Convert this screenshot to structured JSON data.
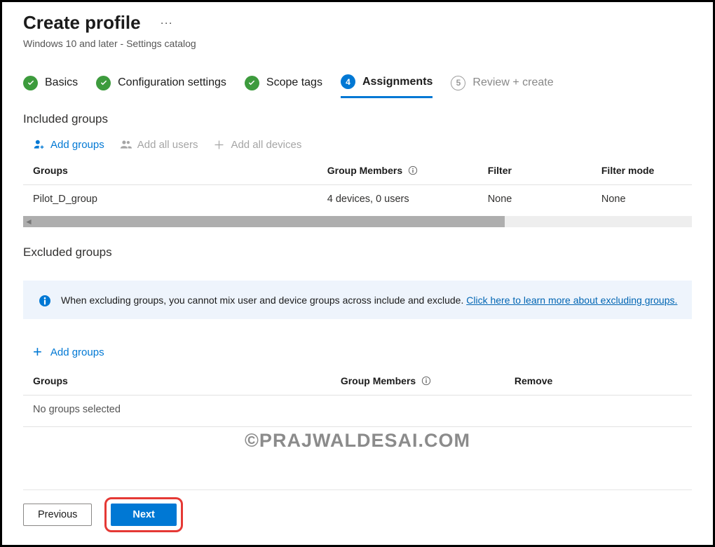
{
  "header": {
    "title": "Create profile",
    "more_label": "···",
    "subtitle": "Windows 10 and later - Settings catalog"
  },
  "wizard": {
    "steps": [
      {
        "label": "Basics",
        "status": "done"
      },
      {
        "label": "Configuration settings",
        "status": "done"
      },
      {
        "label": "Scope tags",
        "status": "done"
      },
      {
        "label": "Assignments",
        "status": "current",
        "number": "4"
      },
      {
        "label": "Review + create",
        "status": "pending",
        "number": "5"
      }
    ]
  },
  "included": {
    "section_title": "Included groups",
    "actions": {
      "add_groups": "Add groups",
      "add_all_users": "Add all users",
      "add_all_devices": "Add all devices"
    },
    "columns": {
      "groups": "Groups",
      "group_members": "Group Members",
      "filter": "Filter",
      "filter_mode": "Filter mode"
    },
    "rows": [
      {
        "group": "Pilot_D_group",
        "members": "4 devices, 0 users",
        "filter": "None",
        "filter_mode": "None"
      }
    ]
  },
  "excluded": {
    "section_title": "Excluded groups",
    "info_message": "When excluding groups, you cannot mix user and device groups across include and exclude. ",
    "info_link": "Click here to learn more about excluding groups.",
    "add_groups_label": "Add groups",
    "columns": {
      "groups": "Groups",
      "group_members": "Group Members",
      "remove": "Remove"
    },
    "empty_message": "No groups selected"
  },
  "watermark": "©PRAJWALDESAI.COM",
  "footer": {
    "previous": "Previous",
    "next": "Next"
  },
  "icons": {
    "person_add": "person-add-icon",
    "people": "people-icon",
    "plus": "plus-icon",
    "info": "info-icon",
    "check": "check-icon"
  }
}
